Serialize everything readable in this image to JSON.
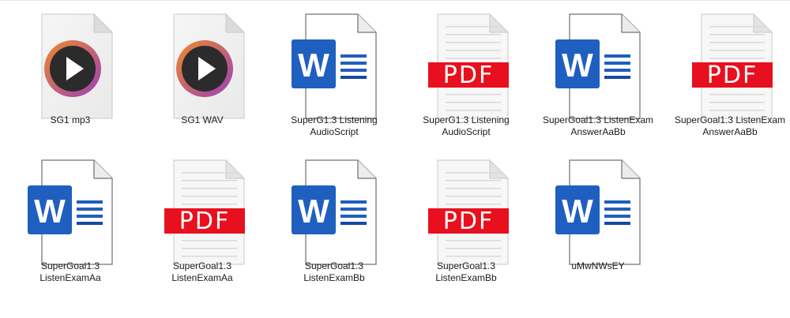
{
  "window": {
    "view": "Large icons"
  },
  "icon_types": {
    "mp3": "media-player-icon",
    "wav": "media-player-icon",
    "docx": "word-document-icon",
    "pdf": "pdf-document-icon"
  },
  "colors": {
    "word_blue": "#1f5fbf",
    "word_blue_dark": "#1549a3",
    "pdf_red": "#e8101e",
    "media_orange": "#f08a2a",
    "media_purple": "#9a3fb8"
  },
  "files": [
    {
      "name": "SG1 mp3",
      "type": "mp3"
    },
    {
      "name": "SG1 WAV",
      "type": "wav"
    },
    {
      "name": "SuperG1.3 Listening\nAudioScript",
      "type": "docx"
    },
    {
      "name": "SuperG1.3 Listening\nAudioScript",
      "type": "pdf"
    },
    {
      "name": "SuperGoal1.3 ListenExam\nAnswerAaBb",
      "type": "docx"
    },
    {
      "name": "SuperGoal1.3 ListenExam\nAnswerAaBb",
      "type": "pdf"
    },
    {
      "name": "SuperGoal1.3 ListenExamAa",
      "type": "docx"
    },
    {
      "name": "SuperGoal1.3 ListenExamAa",
      "type": "pdf"
    },
    {
      "name": "SuperGoal1.3 ListenExamBb",
      "type": "docx"
    },
    {
      "name": "SuperGoal1.3 ListenExamBb",
      "type": "pdf"
    },
    {
      "name": "uMwNWsEY",
      "type": "docx"
    }
  ],
  "labels": {
    "word_letter": "W",
    "pdf_text": "PDF"
  }
}
